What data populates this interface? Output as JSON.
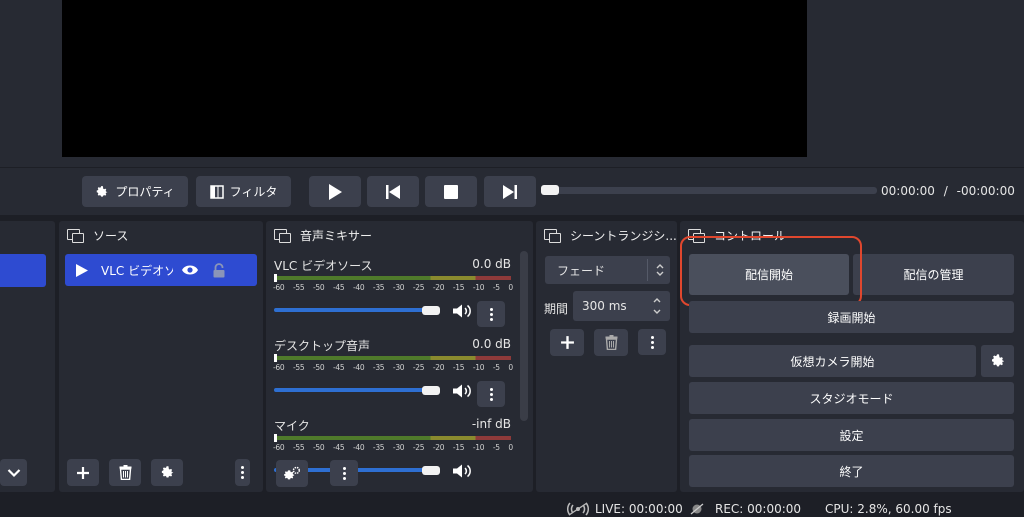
{
  "preview": {},
  "media_toolbar": {
    "properties_label": "プロパティ",
    "filters_label": "フィルタ",
    "time_current": "00:00:00",
    "time_separator": "/",
    "time_remaining": "-00:00:00"
  },
  "sources": {
    "title": "ソース",
    "items": [
      {
        "label": "VLC ビデオソース"
      }
    ]
  },
  "mixer": {
    "title": "音声ミキサー",
    "ticks": [
      "-60",
      "-55",
      "-50",
      "-45",
      "-40",
      "-35",
      "-30",
      "-25",
      "-20",
      "-15",
      "-10",
      "-5",
      "0"
    ],
    "channels": [
      {
        "name": "VLC ビデオソース",
        "level": "0.0 dB",
        "volume_fraction": 1.0
      },
      {
        "name": "デスクトップ音声",
        "level": "0.0 dB",
        "volume_fraction": 1.0
      },
      {
        "name": "マイク",
        "level": "-inf dB",
        "volume_fraction": 1.0
      }
    ]
  },
  "transitions": {
    "title": "シーントランジシ...",
    "selected": "フェード",
    "duration_label": "期間",
    "duration_value": "300 ms"
  },
  "controls": {
    "title": "コントロール",
    "start_stream": "配信開始",
    "manage_stream": "配信の管理",
    "start_recording": "録画開始",
    "start_virtual_cam": "仮想カメラ開始",
    "studio_mode": "スタジオモード",
    "settings": "設定",
    "exit": "終了",
    "highlight_color": "#e0472e"
  },
  "status_bar": {
    "live": "LIVE: 00:00:00",
    "rec": "REC: 00:00:00",
    "cpu": "CPU: 2.8%, 60.00 fps"
  },
  "colors": {
    "accent": "#2e4bd1",
    "slider": "#2e6fd2",
    "background": "#1d1f26",
    "panel": "#272a33",
    "button": "#3c404d"
  }
}
